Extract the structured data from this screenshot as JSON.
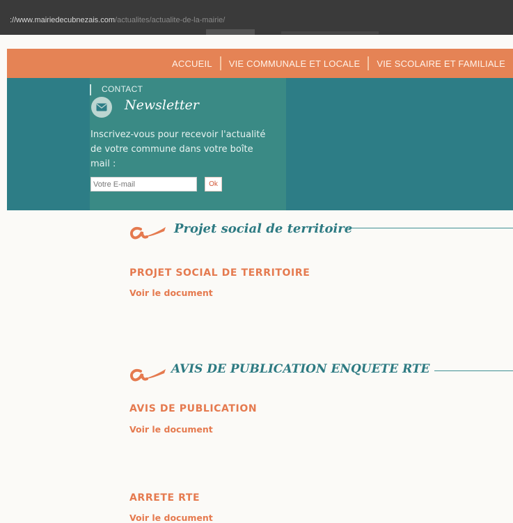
{
  "browser": {
    "url_host": "://www.mairiedecubnezais.com",
    "url_path": "/actualites/actualite-de-la-mairie/"
  },
  "nav": {
    "items": [
      "ACCUEIL",
      "VIE COMMUNALE ET LOCALE",
      "VIE SCOLAIRE ET FAMILIALE"
    ]
  },
  "newsletter": {
    "contact_label": "CONTACT",
    "title": "Newsletter",
    "description": "Inscrivez-vous pour recevoir l'actualité de votre commune dans votre boîte mail :",
    "email_placeholder": "Votre E-mail",
    "ok_label": "Ok"
  },
  "sections": [
    {
      "heading": "Projet social de territoire",
      "items": [
        {
          "title": "PROJET SOCIAL DE TERRITOIRE",
          "link": "Voir le document"
        }
      ]
    },
    {
      "heading": "AVIS DE PUBLICATION ENQUETE RTE",
      "items": [
        {
          "title": "AVIS DE PUBLICATION",
          "link": "Voir le document"
        },
        {
          "title": "ARRETE RTE",
          "link": "Voir le document"
        }
      ]
    }
  ],
  "colors": {
    "nav_bg": "#e58355",
    "banner_bg": "#2d7d86",
    "accent_orange": "#e57a4f",
    "heading_teal": "#2d7a82"
  },
  "icons": {
    "mail": "envelope-icon",
    "section_logo": "a-swash-logo-icon"
  }
}
